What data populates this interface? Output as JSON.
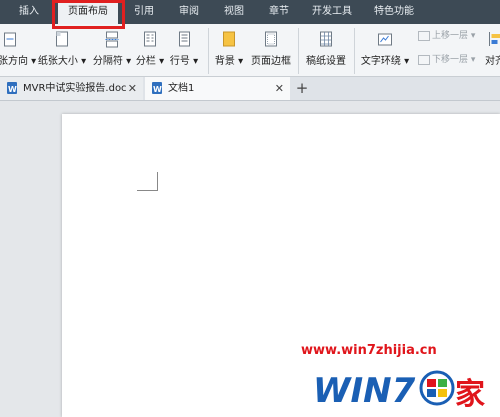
{
  "menu": {
    "tabs": [
      {
        "label": "插入"
      },
      {
        "label": "页面布局",
        "active": true
      },
      {
        "label": "引用"
      },
      {
        "label": "审阅"
      },
      {
        "label": "视图"
      },
      {
        "label": "章节"
      },
      {
        "label": "开发工具"
      },
      {
        "label": "特色功能"
      }
    ]
  },
  "ribbon": {
    "orientation": "纸张方向",
    "size": "纸张大小",
    "separator": "分隔符",
    "columns": "分栏",
    "line_numbers": "行号",
    "background": "背景",
    "page_border": "页面边框",
    "manuscript": "稿纸设置",
    "wrap_text": "文字环绕",
    "bring_forward": "上移一层",
    "send_backward": "下移一层",
    "align": "对齐"
  },
  "document_tabs": [
    {
      "label": "MVR中试实验报告.doc"
    },
    {
      "label": "文档1",
      "active": true
    }
  ],
  "watermark": {
    "url": "www.win7zhijia.cn",
    "logo_text": "WIN7",
    "logo_char": "家"
  },
  "colors": {
    "highlight": "#e02020",
    "menubar": "#3d4a55",
    "watermark_red": "#e0151b",
    "logo_blue": "#1a5fb4"
  }
}
